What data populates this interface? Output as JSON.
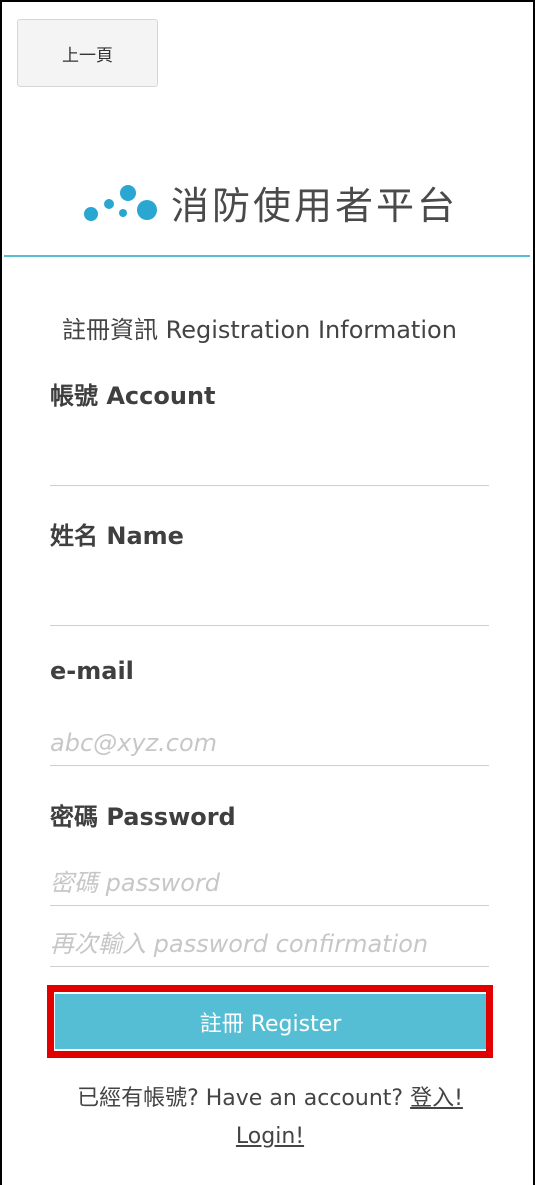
{
  "nav": {
    "back_label": "上一頁"
  },
  "brand": {
    "title": "消防使用者平台",
    "logo_icon": "dots-logo-icon",
    "logo_color": "#2aa7d0"
  },
  "accent_color": "#55bed4",
  "form": {
    "section_title": "註冊資訊 Registration Information",
    "account": {
      "label": "帳號 Account",
      "value": "",
      "placeholder": ""
    },
    "name": {
      "label": "姓名 Name",
      "value": "",
      "placeholder": ""
    },
    "email": {
      "label": "e-mail",
      "value": "",
      "placeholder": "abc@xyz.com"
    },
    "password": {
      "label": "密碼 Password",
      "placeholder": "密碼 password",
      "confirm_placeholder": "再次輸入 password confirmation"
    },
    "register_label": "註冊 Register"
  },
  "login": {
    "prompt": "已經有帳號? Have an account? ",
    "link_label": "登入! Login!"
  },
  "highlight_color": "#e10000"
}
